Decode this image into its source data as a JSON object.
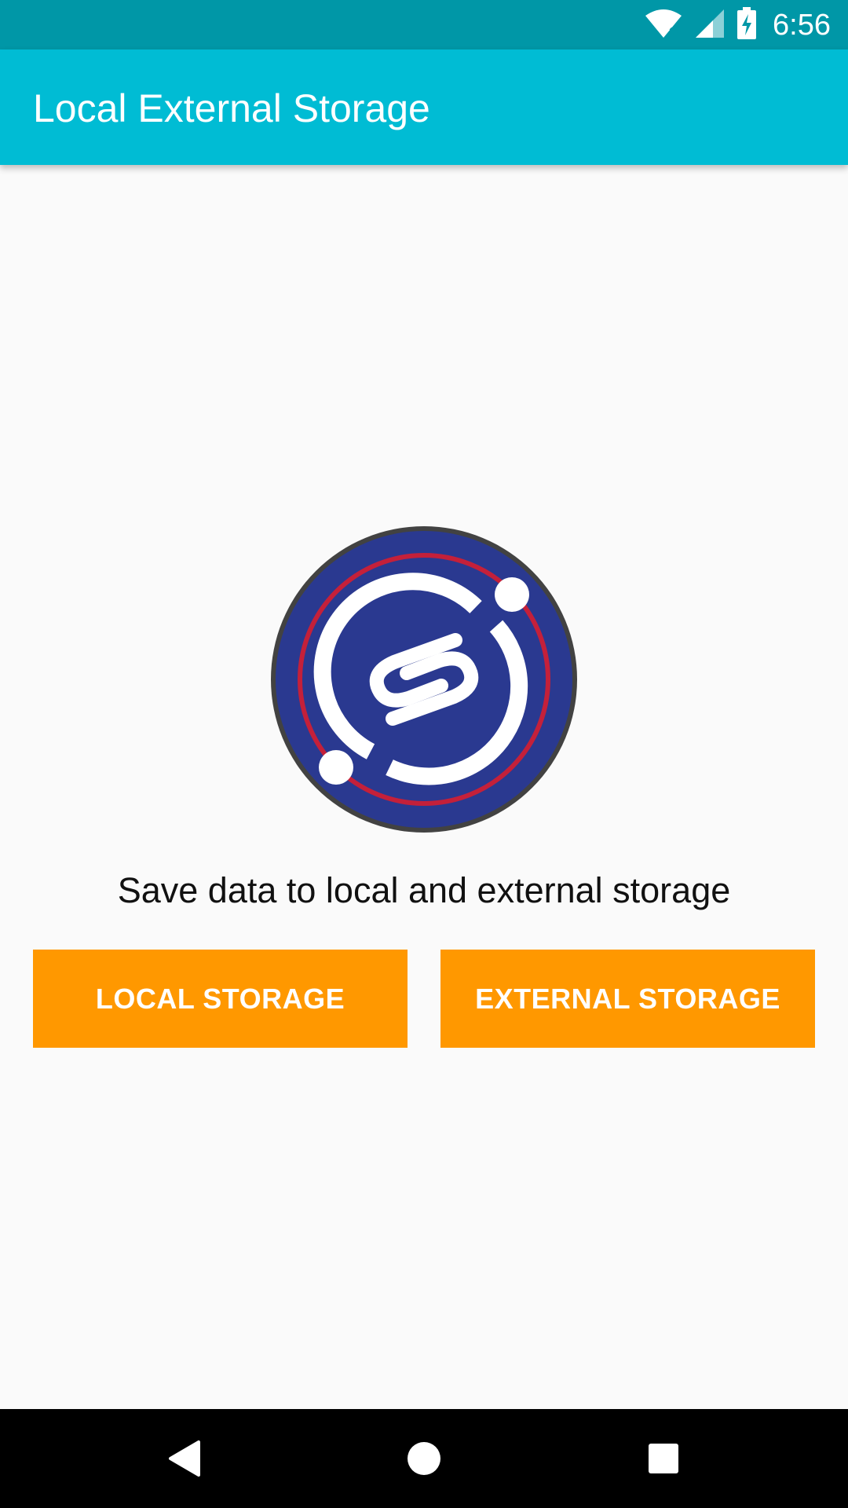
{
  "status_bar": {
    "time": "6:56",
    "icons": [
      "wifi-icon",
      "cell-signal-icon",
      "battery-charging-icon"
    ],
    "background": "#0097a7"
  },
  "app_bar": {
    "title": "Local External Storage",
    "background": "#00bcd4"
  },
  "main": {
    "logo_icon": "storage-logo-icon",
    "subtitle": "Save data to local and external storage",
    "buttons": {
      "local_label": "LOCAL STORAGE",
      "external_label": "EXTERNAL STORAGE",
      "color": "#ff9800"
    }
  },
  "nav_bar": {
    "icons": [
      "back-icon",
      "home-icon",
      "recents-icon"
    ]
  },
  "colors": {
    "accent": "#ff9800",
    "primary": "#00bcd4",
    "primary_dark": "#0097a7",
    "logo_blue": "#2a3990",
    "logo_red": "#c4203a"
  }
}
